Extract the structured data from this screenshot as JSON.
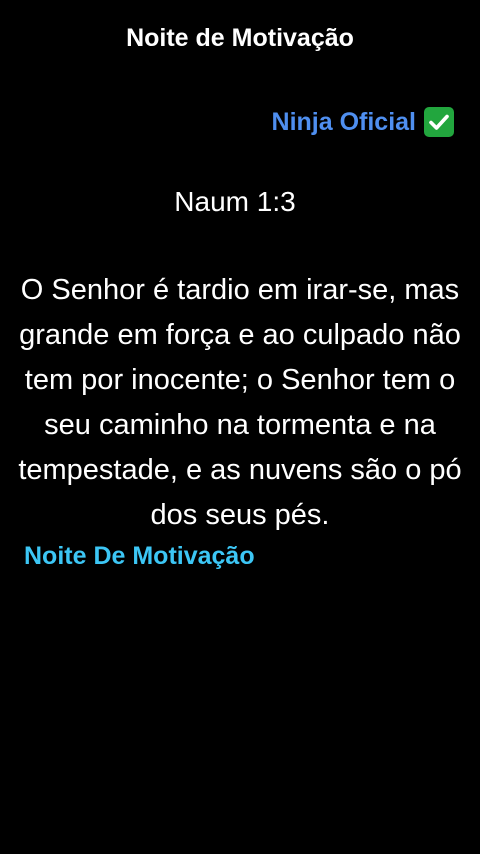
{
  "header": {
    "title": "Noite de Motivação"
  },
  "author": {
    "name": "Ninja Oficial",
    "badge_icon": "check-mark-button-icon",
    "badge_color": "#22a63e",
    "name_color": "#4f8ff0"
  },
  "verse": {
    "reference": "Naum 1:3",
    "text": "O Senhor é tardio em irar-se, mas grande em força e ao culpado não tem por inocente; o Senhor tem o seu caminho na tormenta e na tempestade, e as nuvens são o pó dos seus pés."
  },
  "signature": {
    "text": "Noite De Motivação",
    "color": "#3cc6f5"
  },
  "colors": {
    "background": "#000000",
    "text": "#ffffff"
  }
}
